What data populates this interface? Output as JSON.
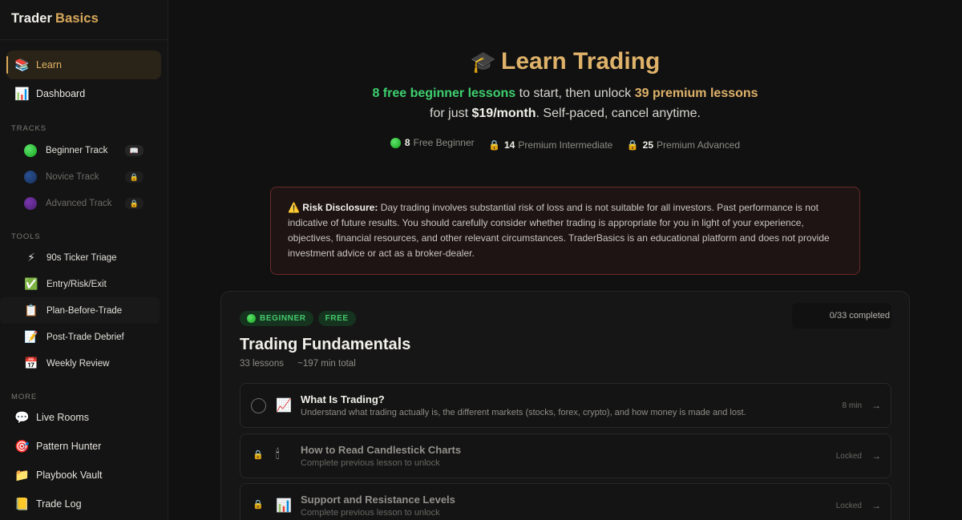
{
  "brand": {
    "name1": "Trader",
    "name2": "Basics"
  },
  "sidebar": {
    "primary": [
      {
        "icon": "books-icon",
        "glyph": "📚",
        "label": "Learn",
        "active": true
      },
      {
        "icon": "bar-chart-icon",
        "glyph": "📊",
        "label": "Dashboard"
      }
    ],
    "tracks_label": "TRACKS",
    "tracks": [
      {
        "label": "Beginner Track",
        "badge": "📖",
        "color": "green"
      },
      {
        "label": "Novice Track",
        "badge": "🔒",
        "color": "blue"
      },
      {
        "label": "Advanced Track",
        "badge": "🔒",
        "color": "purple"
      }
    ],
    "tools_label": "TOOLS",
    "tools": [
      {
        "icon": "lightning-icon",
        "glyph": "⚡",
        "label": "90s Ticker Triage"
      },
      {
        "icon": "check-box-icon",
        "glyph": "✅",
        "label": "Entry/Risk/Exit"
      },
      {
        "icon": "clipboard-icon",
        "glyph": "📋",
        "label": "Plan-Before-Trade"
      },
      {
        "icon": "memo-icon",
        "glyph": "📝",
        "label": "Post-Trade Debrief"
      },
      {
        "icon": "calendar-icon",
        "glyph": "📅",
        "label": "Weekly Review"
      }
    ],
    "more_label": "MORE",
    "more": [
      {
        "icon": "speech-bubble-icon",
        "glyph": "💬",
        "label": "Live Rooms"
      },
      {
        "icon": "target-icon",
        "glyph": "🎯",
        "label": "Pattern Hunter"
      },
      {
        "icon": "folder-icon",
        "glyph": "📁",
        "label": "Playbook Vault"
      },
      {
        "icon": "notepad-icon",
        "glyph": "📒",
        "label": "Trade Log"
      }
    ]
  },
  "hero": {
    "title": "Learn Trading",
    "line1": {
      "green": "8 free beginner lessons",
      "mid": "to start, then unlock",
      "orange": "39 premium lessons"
    },
    "line2": {
      "pre": "for just",
      "price": "$19/month",
      "post": ". Self-paced, cancel anytime."
    },
    "stats": [
      {
        "num": "8",
        "label": "Free Beginner"
      },
      {
        "num": "14",
        "label": "Premium Intermediate"
      },
      {
        "num": "25",
        "label": "Premium Advanced"
      }
    ]
  },
  "risk": {
    "label": "Risk Disclosure:",
    "text": "Day trading involves substantial risk of loss and is not suitable for all investors. Past performance is not indicative of future results. You should carefully consider whether trading is appropriate for you in light of your experience, objectives, financial resources, and other relevant circumstances. TraderBasics is an educational platform and does not provide investment advice or act as a broker-dealer."
  },
  "course": {
    "tag_level": "BEGINNER",
    "tag_price": "FREE",
    "progress": "0/33 completed",
    "title": "Trading Fundamentals",
    "lessons_count": "33 lessons",
    "total_time": "~197 min total",
    "lessons": [
      {
        "title": "What Is Trading?",
        "desc": "Understand what trading actually is, the different markets (stocks, forex, crypto), and how money is made and lost.",
        "right": "8 min",
        "emoji": "📈"
      },
      {
        "title": "How to Read Candlestick Charts",
        "desc": "Complete previous lesson to unlock",
        "right": "Locked",
        "emoji": "🕯"
      },
      {
        "title": "Support and Resistance Levels",
        "desc": "Complete previous lesson to unlock",
        "right": "Locked",
        "emoji": "📊"
      }
    ]
  }
}
